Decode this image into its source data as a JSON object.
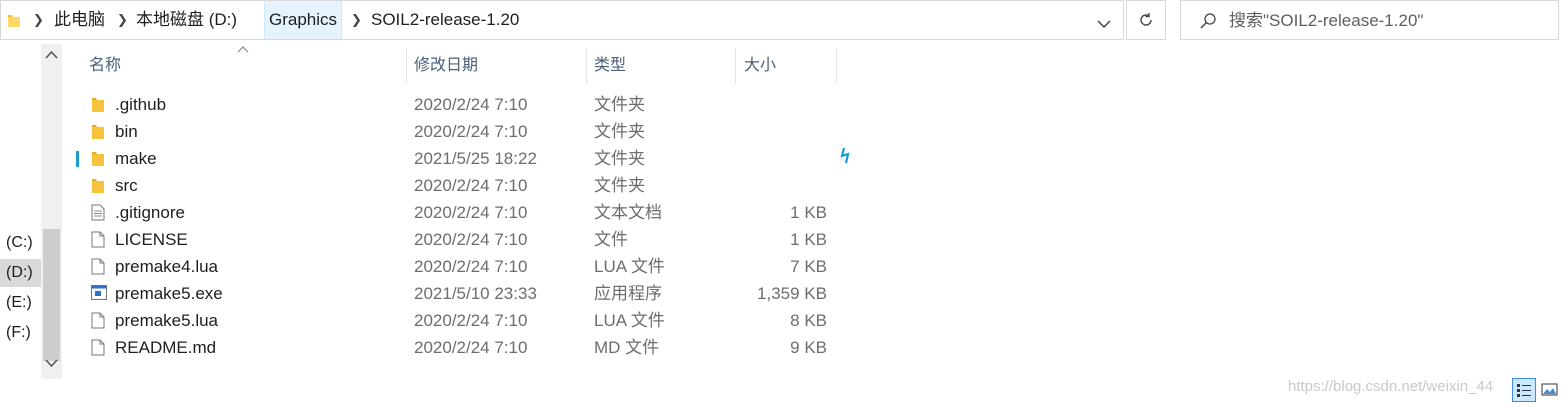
{
  "address_bar": {
    "crumbs": [
      "此电脑",
      "本地磁盘 (D:)",
      "Graphics",
      "SOIL2-release-1.20"
    ]
  },
  "search": {
    "placeholder": "搜索\"SOIL2-release-1.20\""
  },
  "nav": {
    "drives": [
      "(C:)",
      "(D:)",
      "(E:)",
      "(F:)"
    ],
    "selected_index": 1
  },
  "columns": {
    "name": "名称",
    "date": "修改日期",
    "type": "类型",
    "size": "大小"
  },
  "files": [
    {
      "name": ".github",
      "date": "2020/2/24 7:10",
      "type": "文件夹",
      "size": "",
      "icon": "folder-icon"
    },
    {
      "name": "bin",
      "date": "2020/2/24 7:10",
      "type": "文件夹",
      "size": "",
      "icon": "folder-icon"
    },
    {
      "name": "make",
      "date": "2021/5/25 18:22",
      "type": "文件夹",
      "size": "",
      "icon": "folder-icon"
    },
    {
      "name": "src",
      "date": "2020/2/24 7:10",
      "type": "文件夹",
      "size": "",
      "icon": "folder-icon"
    },
    {
      "name": ".gitignore",
      "date": "2020/2/24 7:10",
      "type": "文本文档",
      "size": "1 KB",
      "icon": "text-document-icon"
    },
    {
      "name": "LICENSE",
      "date": "2020/2/24 7:10",
      "type": "文件",
      "size": "1 KB",
      "icon": "file-icon"
    },
    {
      "name": "premake4.lua",
      "date": "2020/2/24 7:10",
      "type": "LUA 文件",
      "size": "7 KB",
      "icon": "file-icon"
    },
    {
      "name": "premake5.exe",
      "date": "2021/5/10 23:33",
      "type": "应用程序",
      "size": "1,359 KB",
      "icon": "application-icon"
    },
    {
      "name": "premake5.lua",
      "date": "2020/2/24 7:10",
      "type": "LUA 文件",
      "size": "8 KB",
      "icon": "file-icon"
    },
    {
      "name": "README.md",
      "date": "2020/2/24 7:10",
      "type": "MD 文件",
      "size": "9 KB",
      "icon": "file-icon"
    }
  ],
  "watermark": "https://blog.csdn.net/weixin_44",
  "colors": {
    "folder": "#f8c33c",
    "header_text": "#4c607a",
    "selection": "#cce8ff",
    "highlight_crumb": "#e5f3ff"
  }
}
